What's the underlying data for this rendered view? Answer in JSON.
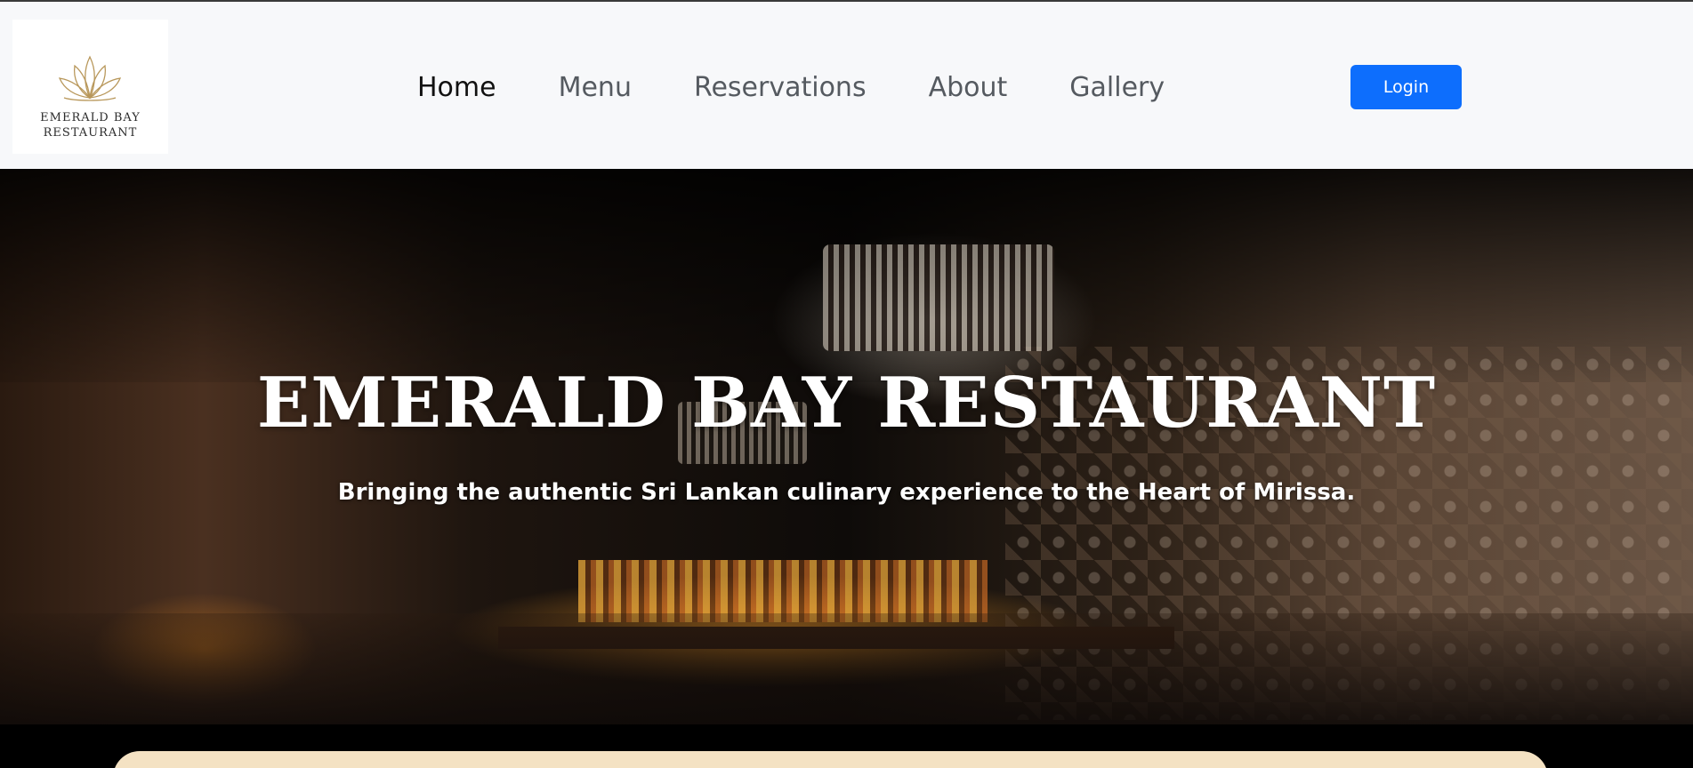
{
  "navbar": {
    "logo": {
      "line1": "EMERALD BAY",
      "line2": "RESTAURANT",
      "icon": "lotus-icon"
    },
    "links": [
      {
        "label": "Home",
        "active": true
      },
      {
        "label": "Menu",
        "active": false
      },
      {
        "label": "Reservations",
        "active": false
      },
      {
        "label": "About",
        "active": false
      },
      {
        "label": "Gallery",
        "active": false
      }
    ],
    "login_label": "Login"
  },
  "hero": {
    "title": "EMERALD BAY RESTAURANT",
    "subtitle": "Bringing the authentic Sri Lankan culinary experience to the Heart of Mirissa."
  },
  "colors": {
    "navbar_bg": "#f7f8fa",
    "primary_button": "#0d6efd",
    "card_bg": "#f4e2c3",
    "logo_gold": "#b8975a"
  }
}
